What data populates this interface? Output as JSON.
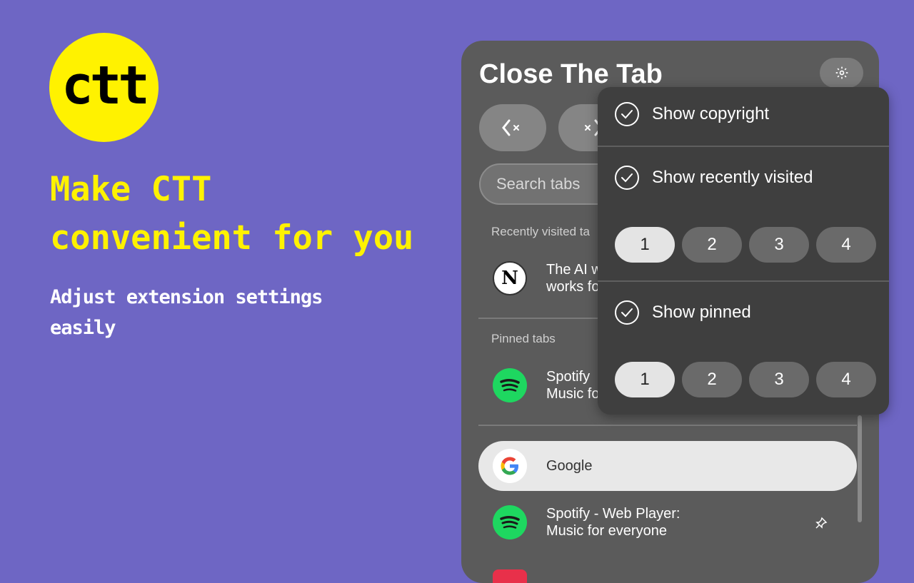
{
  "promo": {
    "logo_text": "ctt",
    "headline_line1": "Make CTT",
    "headline_line2": "convenient for you",
    "subline": "Adjust extension settings easily"
  },
  "popup": {
    "title": "Close The Tab",
    "settings_icon": "gear-icon",
    "action_buttons": [
      {
        "icon": "close-tabs-left-icon",
        "glyph": "‹×"
      },
      {
        "icon": "close-tabs-right-icon",
        "glyph": "×›"
      }
    ],
    "search": {
      "placeholder": "Search tabs"
    },
    "sections": {
      "recent_label": "Recently visited ta",
      "pinned_label": "Pinned tabs"
    },
    "recent_tab": {
      "icon": "notion-icon",
      "line1": "The AI w",
      "line2": "works fo"
    },
    "pinned_tab": {
      "icon": "spotify-icon",
      "line1": "Spotify",
      "line2": "Music fo"
    },
    "tabs": [
      {
        "icon": "google-icon",
        "title": "Google",
        "highlighted": true
      },
      {
        "icon": "spotify-icon",
        "line1": "Spotify - Web Player:",
        "line2": "Music for everyone",
        "pinned": true
      }
    ]
  },
  "settings_menu": {
    "options": [
      {
        "label": "Show copyright",
        "checked": true
      },
      {
        "label": "Show recently visited",
        "checked": true,
        "counts": [
          "1",
          "2",
          "3",
          "4"
        ],
        "selected": "1"
      },
      {
        "label": "Show pinned",
        "checked": true,
        "counts": [
          "1",
          "2",
          "3",
          "4"
        ],
        "selected": "1"
      }
    ]
  },
  "colors": {
    "background": "#6e66c4",
    "accent_yellow": "#fff200",
    "panel": "#5b5b5b",
    "dropdown": "#3f3f3f",
    "spotify_green": "#1ed760"
  }
}
